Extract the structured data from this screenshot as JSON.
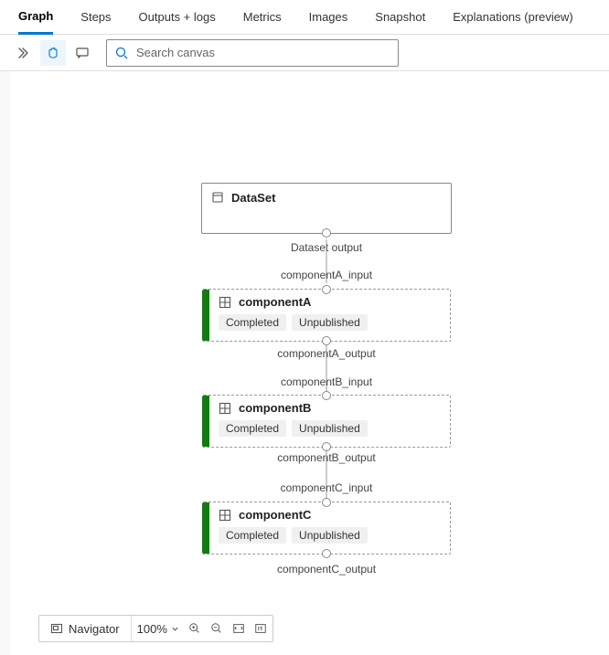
{
  "tabs": [
    "Graph",
    "Steps",
    "Outputs + logs",
    "Metrics",
    "Images",
    "Snapshot",
    "Explanations (preview)"
  ],
  "active_tab": 0,
  "search": {
    "placeholder": "Search canvas"
  },
  "nodes": {
    "dataset": {
      "label": "DataSet",
      "output_label": "Dataset output"
    },
    "compA": {
      "title": "componentA",
      "status1": "Completed",
      "status2": "Unpublished",
      "input_label": "componentA_input",
      "output_label": "componentA_output"
    },
    "compB": {
      "title": "componentB",
      "status1": "Completed",
      "status2": "Unpublished",
      "input_label": "componentB_input",
      "output_label": "componentB_output"
    },
    "compC": {
      "title": "componentC",
      "status1": "Completed",
      "status2": "Unpublished",
      "input_label": "componentC_input",
      "output_label": "componentC_output"
    }
  },
  "footer": {
    "navigator": "Navigator",
    "zoom": "100%"
  }
}
